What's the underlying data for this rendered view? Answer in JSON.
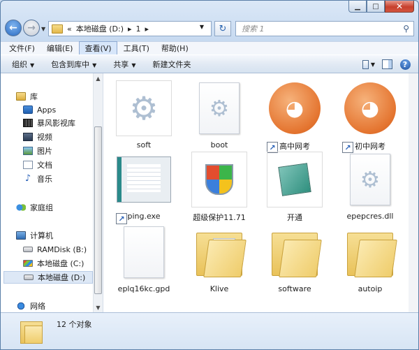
{
  "address": {
    "path": [
      "«",
      "本地磁盘 (D:)",
      "▸",
      "1",
      "▸"
    ]
  },
  "search": {
    "placeholder": "搜索 1"
  },
  "menu": [
    "文件(F)",
    "编辑(E)",
    "查看(V)",
    "工具(T)",
    "帮助(H)"
  ],
  "toolbar": {
    "organize": "组织",
    "include": "包含到库中",
    "share": "共享",
    "new_folder": "新建文件夹"
  },
  "sidebar": {
    "library": "库",
    "apps": "Apps",
    "movie": "暴风影视库",
    "video": "视频",
    "pictures": "图片",
    "documents": "文档",
    "music": "音乐",
    "homegroup": "家庭组",
    "computer": "计算机",
    "ramdisk": "RAMDisk (B:)",
    "drive_c": "本地磁盘 (C:)",
    "drive_d": "本地磁盘 (D:)",
    "network": "网络"
  },
  "files": [
    {
      "name": "soft"
    },
    {
      "name": "boot"
    },
    {
      "name": "高中网考"
    },
    {
      "name": "初中网考"
    },
    {
      "name": "ping.exe"
    },
    {
      "name": "超级保护11.71"
    },
    {
      "name": "开通"
    },
    {
      "name": "epepcres.dll"
    },
    {
      "name": "eplq16kc.gpd"
    },
    {
      "name": "Klive"
    },
    {
      "name": "software"
    },
    {
      "name": "autoip"
    }
  ],
  "status": {
    "count": "12 个对象"
  }
}
